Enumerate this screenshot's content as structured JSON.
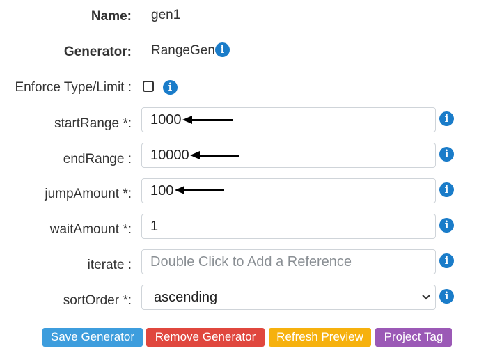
{
  "rows": {
    "name": {
      "label": "Name:",
      "value": "gen1"
    },
    "generator": {
      "label": "Generator:",
      "value": "RangeGen"
    },
    "enforce": {
      "label": "Enforce Type/Limit :"
    },
    "start_range": {
      "label": "startRange *:",
      "value": "1000"
    },
    "end_range": {
      "label": "endRange :",
      "value": "10000"
    },
    "jump_amount": {
      "label": "jumpAmount *:",
      "value": "100"
    },
    "wait_amount": {
      "label": "waitAmount *:",
      "value": "1"
    },
    "iterate": {
      "label": "iterate :",
      "placeholder": "Double Click to Add a Reference"
    },
    "sort_order": {
      "label": "sortOrder *:",
      "value": "ascending"
    }
  },
  "info_glyph": "i",
  "buttons": {
    "save": "Save Generator",
    "remove": "Remove Generator",
    "refresh": "Refresh Preview",
    "project_tag": "Project Tag"
  },
  "colors": {
    "info": "#1a7cc9",
    "save": "#3d9ddd",
    "remove": "#e0473e",
    "refresh": "#f6b10e",
    "project_tag": "#9b59b6"
  },
  "icons": [
    "info-icon",
    "arrow-left-icon",
    "chevron-down-icon"
  ]
}
